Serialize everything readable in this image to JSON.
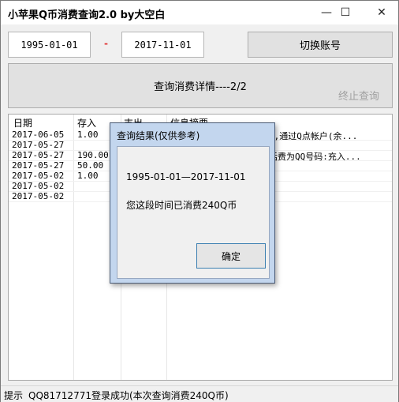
{
  "window": {
    "title": "小苹果Q币消费查询2.0 by大空白",
    "minimize_glyph": "—",
    "maximize_glyph": "☐",
    "close_glyph": "✕"
  },
  "query": {
    "start_date": "1995-01-01",
    "separator": "-",
    "end_date": "2017-11-01",
    "switch_account_label": "切换账号",
    "detail_button_label": "查询消费详情----2/2",
    "stop_label": "终止查询"
  },
  "table": {
    "headers": [
      "日期",
      "存入",
      "支出",
      "信息摘要"
    ],
    "rows": [
      {
        "date": "2017-06-05",
        "deposit": "1.00",
        "expense": "",
        "summary": "),通过Q点帐户(余..."
      },
      {
        "date": "2017-05-27",
        "deposit": "",
        "expense": "",
        "summary": ""
      },
      {
        "date": "2017-05-27",
        "deposit": "190.00",
        "expense": "",
        "summary": "话费为QQ号码:充入..."
      },
      {
        "date": "2017-05-27",
        "deposit": "50.00",
        "expense": "",
        "summary": ""
      },
      {
        "date": "2017-05-02",
        "deposit": "1.00",
        "expense": "",
        "summary": ""
      },
      {
        "date": "2017-05-02",
        "deposit": "",
        "expense": "",
        "summary": ""
      },
      {
        "date": "2017-05-02",
        "deposit": "",
        "expense": "",
        "summary": ""
      }
    ]
  },
  "status": {
    "label": "提示",
    "message": "QQ81712771登录成功(本次查询消费240Q币)"
  },
  "dialog": {
    "title": "查询结果(仅供参考)",
    "range": "1995-01-01—2017-11-01",
    "message": "您这段时间已消费240Q币",
    "ok_label": "确定"
  }
}
